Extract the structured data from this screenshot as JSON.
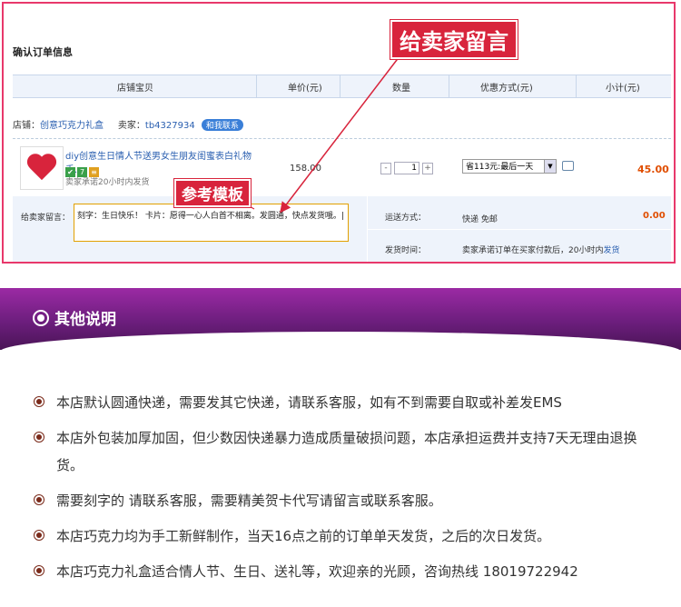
{
  "order": {
    "section_title": "确认订单信息",
    "columns": [
      "店铺宝贝",
      "单价(元)",
      "数量",
      "优惠方式(元)",
      "小计(元)"
    ],
    "shop_label": "店铺：",
    "shop_name": "创意巧克力礼盒",
    "seller_label": "卖家：",
    "seller_id": "tb4327934",
    "contact_label": "和我联系",
    "item_title": "diy创意生日情人节送男女生朋友闺蜜表白礼物 手...",
    "item_promise": "卖家承诺20小时内发货",
    "unit_price": "158.00",
    "qty_minus": "-",
    "qty_value": "1",
    "qty_plus": "+",
    "discount_option": "省113元:最后一天",
    "subtotal": "45.00",
    "message_label": "给卖家留言：",
    "message_text": "刻字：生日快乐！ 卡片：愿得一心人白首不相离。发圆通，快点发货哦。|",
    "shipping_label": "运送方式：",
    "shipping_value": "快递 免邮",
    "shipping_total": "0.00",
    "delivery_label": "发货时间：",
    "delivery_value": "卖家承诺订单在买家付款后，20小时内",
    "delivery_link": "发货"
  },
  "callouts": {
    "leave_message": "给卖家留言",
    "template": "参考模板"
  },
  "banner": {
    "title": "其他说明"
  },
  "notes": [
    "本店默认圆通快递，需要发其它快递，请联系客服，如有不到需要自取或补差发EMS",
    "本店外包装加厚加固，但少数因快递暴力造成质量破损问题，本店承担运费并支持7天无理由退换货。",
    "需要刻字的 请联系客服，需要精美贺卡代写请留言或联系客服。",
    "本店巧克力均为手工新鲜制作，当天16点之前的订单单天发货，之后的次日发货。",
    "本店巧克力礼盒适合情人节、生日、送礼等，欢迎亲的光顾，咨询热线 18019722942"
  ],
  "colors": {
    "frame": "#e8386b",
    "callout": "#d8243c",
    "banner": "#6c1e7d",
    "link": "#2a5fb0",
    "price": "#e04e00"
  }
}
